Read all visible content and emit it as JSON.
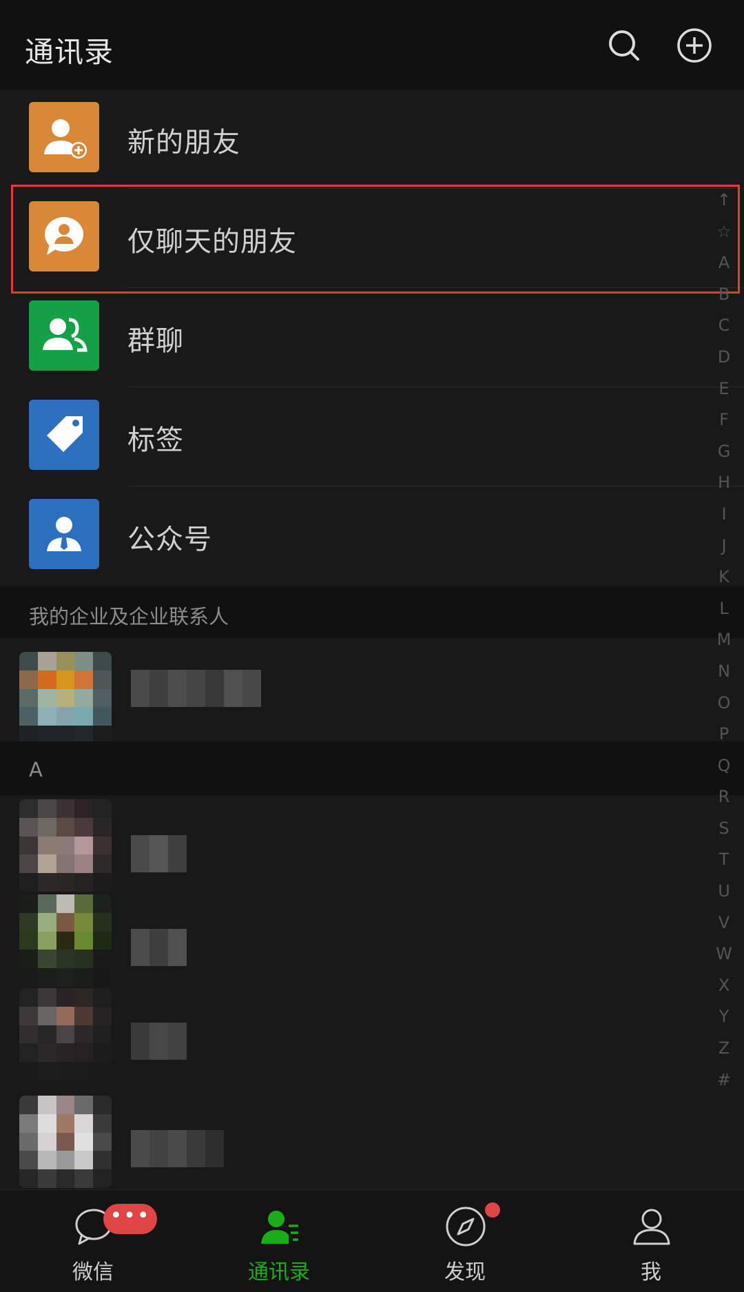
{
  "header": {
    "title": "通讯录",
    "search_icon": "search-icon",
    "add_icon": "add-circle-icon"
  },
  "top_items": [
    {
      "label": "新的朋友",
      "icon": "add-friend-icon",
      "color": "#d98838"
    },
    {
      "label": "仅聊天的朋友",
      "icon": "chat-only-friend-icon",
      "color": "#d98838"
    },
    {
      "label": "群聊",
      "icon": "group-chat-icon",
      "color": "#14a046"
    },
    {
      "label": "标签",
      "icon": "tag-icon",
      "color": "#2d6fbf"
    },
    {
      "label": "公众号",
      "icon": "official-account-icon",
      "color": "#2d6fbf"
    }
  ],
  "enterprise_section": {
    "title": "我的企业及企业联系人"
  },
  "section_a": {
    "letter": "A"
  },
  "index_bar": [
    "↑",
    "☆",
    "A",
    "B",
    "C",
    "D",
    "E",
    "F",
    "G",
    "H",
    "I",
    "J",
    "K",
    "L",
    "M",
    "N",
    "O",
    "P",
    "Q",
    "R",
    "S",
    "T",
    "U",
    "V",
    "W",
    "X",
    "Y",
    "Z",
    "#"
  ],
  "tabbar": {
    "tabs": [
      {
        "label": "微信",
        "icon": "chat-bubble-icon",
        "badge": "•••",
        "active": false
      },
      {
        "label": "通讯录",
        "icon": "contacts-icon",
        "active": true
      },
      {
        "label": "发现",
        "icon": "compass-icon",
        "dot": true,
        "active": false
      },
      {
        "label": "我",
        "icon": "person-icon",
        "active": false
      }
    ]
  },
  "colors": {
    "accent": "#1aad19",
    "highlight_box": "#e23a3a",
    "badge": "#e04545"
  }
}
